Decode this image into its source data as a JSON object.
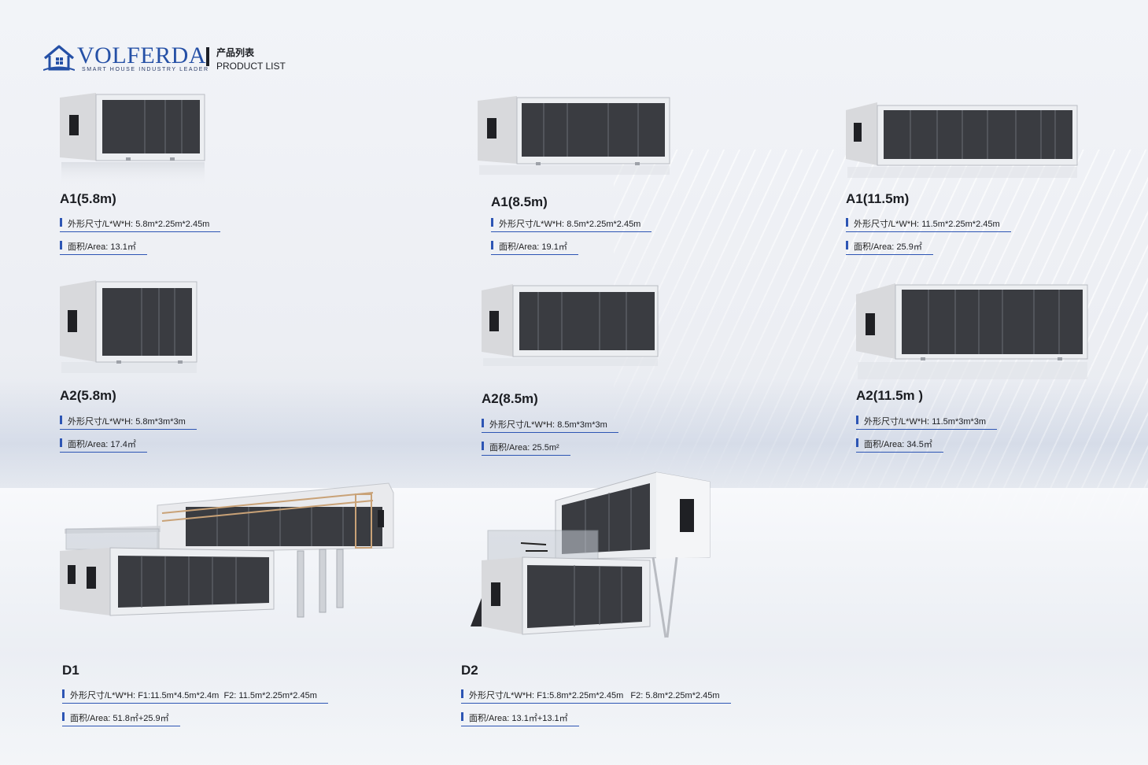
{
  "brand": {
    "name": "VOLFERDA",
    "tagline": "SMART HOUSE INDUSTRY LEADER",
    "accent": "#2550a6"
  },
  "header": {
    "title_zh": "产品列表",
    "title_en": "PRODUCT LIST"
  },
  "products": [
    {
      "name": "A1(5.8m)",
      "dims_label": "外形尺寸/L*W*H:",
      "dims": "5.8m*2.25m*2.45m",
      "area_label": "面积/Area:",
      "area": "13.1㎡"
    },
    {
      "name": "A1(8.5m)",
      "dims_label": "外形尺寸/L*W*H:",
      "dims": "8.5m*2.25m*2.45m",
      "area_label": "面积/Area:",
      "area": "19.1㎡"
    },
    {
      "name": "A1(11.5m)",
      "dims_label": "外形尺寸/L*W*H:",
      "dims": "11.5m*2.25m*2.45m",
      "area_label": "面积/Area:",
      "area": "25.9㎡"
    },
    {
      "name": "A2(5.8m)",
      "dims_label": "外形尺寸/L*W*H:",
      "dims": "5.8m*3m*3m",
      "area_label": "面积/Area:",
      "area": "17.4㎡"
    },
    {
      "name": "A2(8.5m)",
      "dims_label": "外形尺寸/L*W*H:",
      "dims": "8.5m*3m*3m",
      "area_label": "面积/Area:",
      "area": "25.5m²"
    },
    {
      "name": "A2(11.5m )",
      "dims_label": "外形尺寸/L*W*H:",
      "dims": "11.5m*3m*3m",
      "area_label": "面积/Area:",
      "area": "34.5㎡"
    },
    {
      "name": "D1",
      "dims_label": "外形尺寸/L*W*H:",
      "dims": "F1:11.5m*4.5m*2.4m",
      "dims2_label": "F2:",
      "dims2": "11.5m*2.25m*2.45m",
      "area_label": "面积/Area:",
      "area": "51.8㎡+25.9㎡"
    },
    {
      "name": "D2",
      "dims_label": "外形尺寸/L*W*H:",
      "dims": "F1:5.8m*2.25m*2.45m",
      "dims2_label": "F2:",
      "dims2": "5.8m*2.25m*2.45m",
      "area_label": "面积/Area:",
      "area": "13.1㎡+13.1㎡"
    }
  ],
  "colors": {
    "spec_bar": "#2d55b4",
    "glass": "#3a3c41",
    "shell": "#e3e4e7"
  },
  "icons": [
    "house-logo-icon"
  ]
}
